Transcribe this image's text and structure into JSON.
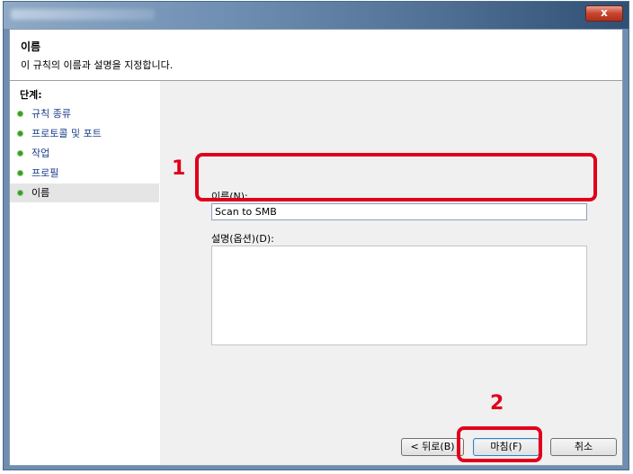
{
  "window": {
    "close_glyph": "x"
  },
  "header": {
    "title": "이름",
    "description": "이 규칙의 이름과 설명을 지정합니다."
  },
  "sidebar": {
    "heading": "단계:",
    "steps": [
      {
        "label": "규칙 종류"
      },
      {
        "label": "프로토콜 및 포트"
      },
      {
        "label": "작업"
      },
      {
        "label": "프로필"
      },
      {
        "label": "이름"
      }
    ]
  },
  "form": {
    "name_label": "이름(N):",
    "name_value": "Scan to SMB",
    "description_label": "설명(옵션)(D):"
  },
  "buttons": {
    "back": "< 뒤로(B)",
    "finish": "마침(F)",
    "cancel": "취소"
  },
  "annotations": {
    "callout_1": "1",
    "callout_2": "2",
    "color": "#e0001b"
  }
}
